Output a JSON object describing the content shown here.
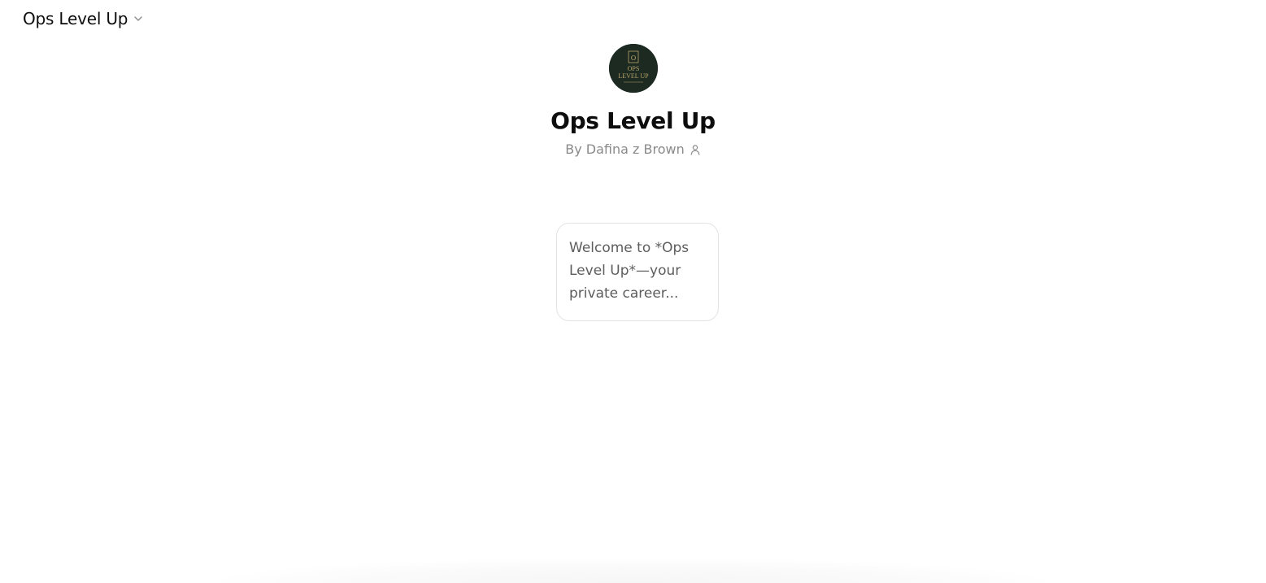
{
  "header": {
    "model_name": "Ops Level Up",
    "chevron_icon": "chevron-down-icon"
  },
  "gpt": {
    "title": "Ops Level Up",
    "byline": "By Dafina z Brown",
    "author_icon": "person-icon",
    "avatar": {
      "background": "#1c2a22",
      "accent": "#b8a46a",
      "logo_line1": "OPS",
      "logo_line2": "LEVEL UP"
    }
  },
  "starters": [
    {
      "text": "Welcome to *Ops Level Up*—your private career..."
    }
  ],
  "colors": {
    "text_primary": "#0d0d0d",
    "text_secondary": "#8a8a8a",
    "card_border": "#e3e3e3"
  }
}
